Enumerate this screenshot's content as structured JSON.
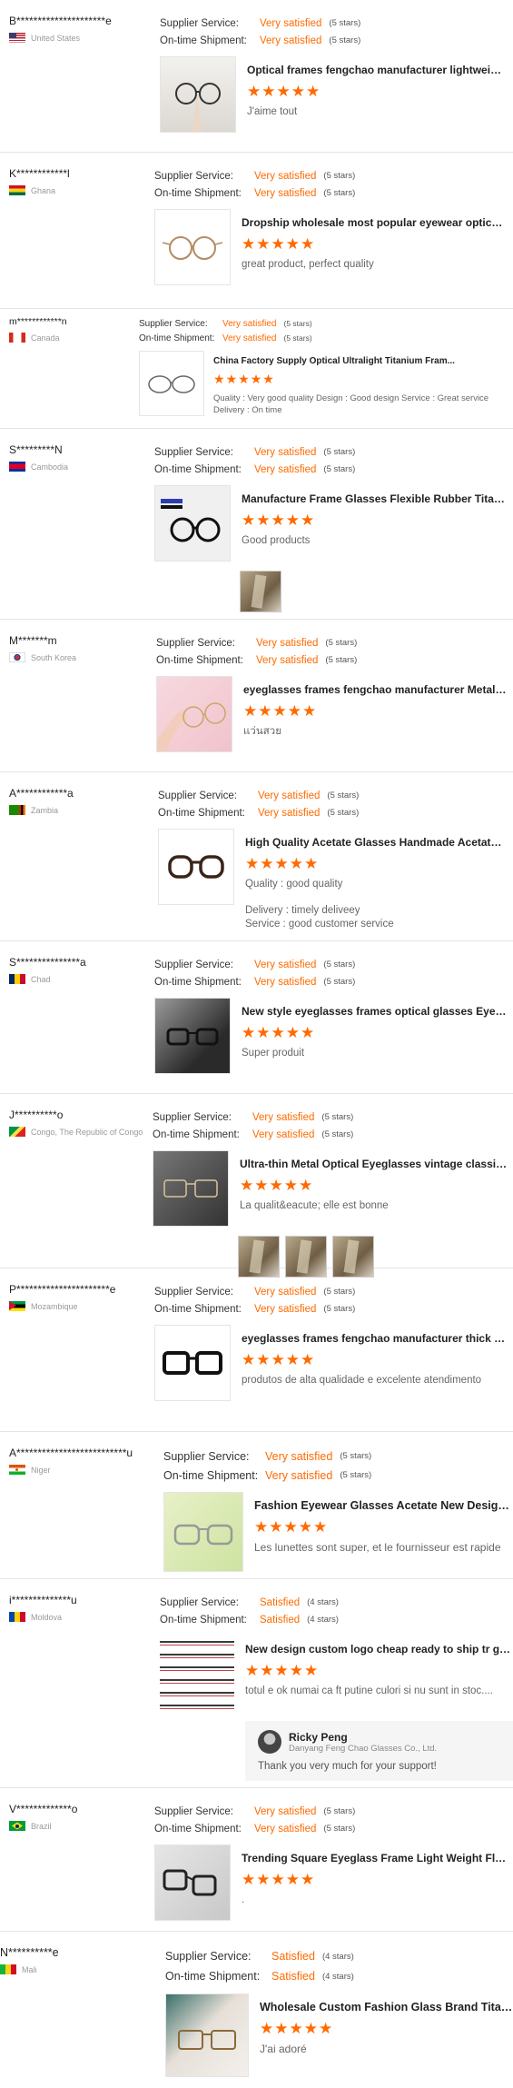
{
  "labels": {
    "supplier_service": "Supplier Service:",
    "on_time_shipment": "On-time Shipment:"
  },
  "reviews": [
    {
      "user": "B*********************e",
      "country": "United States",
      "flag": "us",
      "supplier_rating": "Very satisfied",
      "supplier_count": "(5 stars)",
      "shipment_rating": "Very satisfied",
      "shipment_count": "(5 stars)",
      "product_title": "Optical frames fengchao manufacturer lightweight cu...",
      "stars": 5,
      "comment": "J'aime tout",
      "images": 0
    },
    {
      "user": "K************l",
      "country": "Ghana",
      "flag": "gh",
      "supplier_rating": "Very satisfied",
      "supplier_count": "(5 stars)",
      "shipment_rating": "Very satisfied",
      "shipment_count": "(5 stars)",
      "product_title": "Dropship wholesale most popular eyewear optical fra...",
      "stars": 5,
      "comment": "great product, perfect quality",
      "images": 0
    },
    {
      "user": "m************n",
      "country": "Canada",
      "flag": "ca",
      "supplier_rating": "Very satisfied",
      "supplier_count": "(5 stars)",
      "shipment_rating": "Very satisfied",
      "shipment_count": "(5 stars)",
      "product_title": "China Factory Supply Optical Ultralight Titanium Fram...",
      "stars": 5,
      "comment": "Quality : Very good quality Design : Good design Service : Great service Delivery : On time",
      "images": 0
    },
    {
      "user": "S*********N",
      "country": "Cambodia",
      "flag": "kh",
      "supplier_rating": "Very satisfied",
      "supplier_count": "(5 stars)",
      "shipment_rating": "Very satisfied",
      "shipment_count": "(5 stars)",
      "product_title": "Manufacture Frame Glasses Flexible Rubber Titanium...",
      "stars": 5,
      "comment": "Good products",
      "images": 1
    },
    {
      "user": "M*******m",
      "country": "South Korea",
      "flag": "kr",
      "supplier_rating": "Very satisfied",
      "supplier_count": "(5 stars)",
      "shipment_rating": "Very satisfied",
      "shipment_count": "(5 stars)",
      "product_title": "eyeglasses frames fengchao manufacturer Metal Allo...",
      "stars": 5,
      "comment": "แว่นสวย",
      "images": 0
    },
    {
      "user": "A************a",
      "country": "Zambia",
      "flag": "zm",
      "supplier_rating": "Very satisfied",
      "supplier_count": "(5 stars)",
      "shipment_rating": "Very satisfied",
      "shipment_count": "(5 stars)",
      "product_title": "High Quality Acetate Glasses Handmade Acetate Eye...",
      "stars": 5,
      "comment": "Quality : good quality",
      "comment2": "Delivery : timely deliveey",
      "comment3": "Service : good customer service",
      "images": 0
    },
    {
      "user": "S***************a",
      "country": "Chad",
      "flag": "td",
      "supplier_rating": "Very satisfied",
      "supplier_count": "(5 stars)",
      "shipment_rating": "Very satisfied",
      "shipment_count": "(5 stars)",
      "product_title": "New style eyeglasses frames optical glasses Eyewear...",
      "stars": 5,
      "comment": "Super produit",
      "images": 0
    },
    {
      "user": "J**********o",
      "country": "Congo, The Republic of Congo",
      "flag": "cg",
      "supplier_rating": "Very satisfied",
      "supplier_count": "(5 stars)",
      "shipment_rating": "Very satisfied",
      "shipment_count": "(5 stars)",
      "product_title": "Ultra-thin Metal Optical Eyeglasses vintage classic ro...",
      "stars": 5,
      "comment": "La qualit&eacute; elle est bonne",
      "images": 3
    },
    {
      "user": "P**********************e",
      "country": "Mozambique",
      "flag": "mz",
      "supplier_rating": "Very satisfied",
      "supplier_count": "(5 stars)",
      "shipment_rating": "Very satisfied",
      "shipment_count": "(5 stars)",
      "product_title": "eyeglasses frames fengchao manufacturer thick clas...",
      "stars": 5,
      "comment": "produtos de alta qualidade e excelente atendimento",
      "images": 0
    },
    {
      "user": "A**************************u",
      "country": "Niger",
      "flag": "ne",
      "supplier_rating": "Very satisfied",
      "supplier_count": "(5 stars)",
      "shipment_rating": "Very satisfied",
      "shipment_count": "(5 stars)",
      "product_title": "Fashion Eyewear Glasses Acetate New Design Ship",
      "stars": 5,
      "comment": "Les lunettes sont super, et le fournisseur est rapide",
      "images": 0
    },
    {
      "user": "i**************u",
      "country": "Moldova",
      "flag": "md",
      "supplier_rating": "Satisfied",
      "supplier_count": "(4 stars)",
      "shipment_rating": "Satisfied",
      "shipment_count": "(4 stars)",
      "product_title": "New design custom logo cheap ready to ship tr glass...",
      "stars": 5,
      "comment": "totul e ok numai ca ft putine culori si nu sunt in stoc....",
      "images": 0,
      "reply": {
        "name": "Ricky Peng",
        "company": "Danyang Feng Chao Glasses Co., Ltd.",
        "text": "Thank you very much for your support!"
      }
    },
    {
      "user": "V*************o",
      "country": "Brazil",
      "flag": "br",
      "supplier_rating": "Very satisfied",
      "supplier_count": "(5 stars)",
      "shipment_rating": "Very satisfied",
      "shipment_count": "(5 stars)",
      "product_title": "Trending Square Eyeglass Frame Light Weight Flexibl...",
      "stars": 5,
      "comment": ".",
      "images": 0
    },
    {
      "user": "N**********e",
      "country": "Mali",
      "flag": "ml",
      "supplier_rating": "Satisfied",
      "supplier_count": "(4 stars)",
      "shipment_rating": "Satisfied",
      "shipment_count": "(4 stars)",
      "product_title": "Wholesale Custom Fashion Glass Brand Titanium",
      "stars": 5,
      "comment": "J'ai adoré",
      "images": 0
    }
  ],
  "icons": {
    "star": "★",
    "flag": "country-flag",
    "avatar": "user-avatar"
  },
  "colors": {
    "rating": "#ff6a00",
    "stars": "#ff6a00"
  }
}
